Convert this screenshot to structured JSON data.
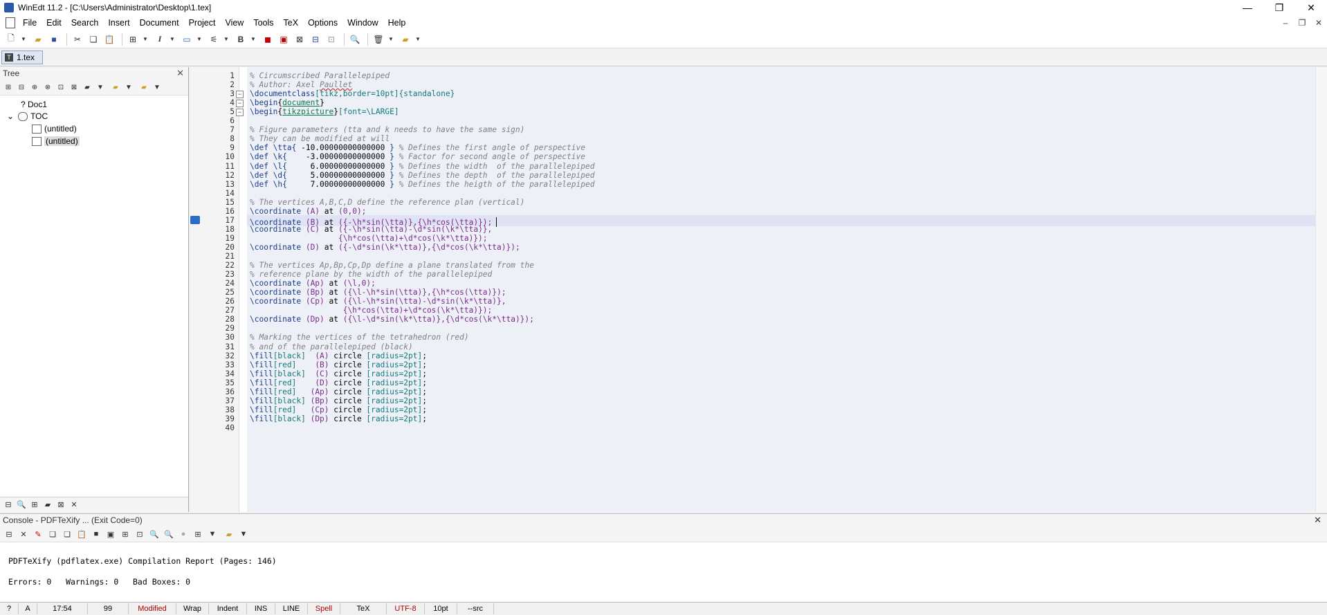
{
  "window": {
    "title": "WinEdt 11.2 - [C:\\Users\\Administrator\\Desktop\\1.tex]",
    "minimize": "—",
    "restore": "❐",
    "close": "✕"
  },
  "menu": [
    "File",
    "Edit",
    "Search",
    "Insert",
    "Document",
    "Project",
    "View",
    "Tools",
    "TeX",
    "Options",
    "Window",
    "Help"
  ],
  "tabs": [
    {
      "label": "1.tex",
      "icon": "T"
    }
  ],
  "tree": {
    "title": "Tree",
    "nodes": [
      {
        "label": "? Doc1",
        "level": 1
      },
      {
        "label": "TOC",
        "level": 0
      },
      {
        "label": "(untitled)",
        "level": 2
      },
      {
        "label": "(untitled)",
        "level": 2,
        "selected": true
      }
    ]
  },
  "editor": {
    "current_line": 17,
    "lines": [
      [
        [
          "c-cmt",
          "% Circumscribed Parallelepiped"
        ]
      ],
      [
        [
          "c-cmt",
          "% Author: Axel "
        ],
        [
          "c-cmt c-sq",
          "Paullet"
        ]
      ],
      [
        [
          "c-cmd",
          "\\documentclass"
        ],
        [
          "c-teal",
          "[tikz,border=10pt]{standalone}"
        ]
      ],
      [
        [
          "c-cmd",
          "\\begin"
        ],
        [
          "c-blk",
          "{"
        ],
        [
          "c-grn",
          "document"
        ],
        [
          "c-blk",
          "}"
        ]
      ],
      [
        [
          "c-cmd",
          "\\begin"
        ],
        [
          "c-blk",
          "{"
        ],
        [
          "c-grn",
          "tikzpicture"
        ],
        [
          "c-blk",
          "}"
        ],
        [
          "c-teal",
          "[font=\\LARGE]"
        ]
      ],
      [],
      [
        [
          "c-cmt",
          "% Figure parameters (tta and k needs to have the same sign)"
        ]
      ],
      [
        [
          "c-cmt",
          "% They can be modified at will"
        ]
      ],
      [
        [
          "c-cmd",
          "\\def \\tta{ "
        ],
        [
          "c-blk",
          "-10.00000000000000 "
        ],
        [
          "c-cmd",
          "} "
        ],
        [
          "c-cmt",
          "% Defines the first angle of perspective"
        ]
      ],
      [
        [
          "c-cmd",
          "\\def \\k{    "
        ],
        [
          "c-blk",
          "-3.00000000000000 "
        ],
        [
          "c-cmd",
          "} "
        ],
        [
          "c-cmt",
          "% Factor for second angle of perspective"
        ]
      ],
      [
        [
          "c-cmd",
          "\\def \\l{     "
        ],
        [
          "c-blk",
          "6.00000000000000 "
        ],
        [
          "c-cmd",
          "} "
        ],
        [
          "c-cmt",
          "% Defines the width  of the parallelepiped"
        ]
      ],
      [
        [
          "c-cmd",
          "\\def \\d{     "
        ],
        [
          "c-blk",
          "5.00000000000000 "
        ],
        [
          "c-cmd",
          "} "
        ],
        [
          "c-cmt",
          "% Defines the depth  of the parallelepiped"
        ]
      ],
      [
        [
          "c-cmd",
          "\\def \\h{     "
        ],
        [
          "c-blk",
          "7.00000000000000 "
        ],
        [
          "c-cmd",
          "} "
        ],
        [
          "c-cmt",
          "% Defines the heigth of the parallelepiped"
        ]
      ],
      [],
      [
        [
          "c-cmt",
          "% The vertices A,B,C,D define the reference plan (vertical)"
        ]
      ],
      [
        [
          "c-cmd",
          "\\coordinate "
        ],
        [
          "c-pur",
          "(A) "
        ],
        [
          "c-blk",
          "at "
        ],
        [
          "c-pur",
          "(0,0);"
        ]
      ],
      [
        [
          "c-cmd",
          "\\coordinate "
        ],
        [
          "c-pur",
          "(B) "
        ],
        [
          "c-blk",
          "at "
        ],
        [
          "c-pur",
          "({-\\h*sin(\\tta)},{\\h*cos(\\tta)});"
        ]
      ],
      [
        [
          "c-cmd",
          "\\coordinate "
        ],
        [
          "c-pur",
          "(C) "
        ],
        [
          "c-blk",
          "at "
        ],
        [
          "c-pur",
          "({-\\h*sin(\\tta)-\\d*sin(\\k*\\tta)},"
        ]
      ],
      [
        [
          "c-pur",
          "                   {\\h*cos(\\tta)+\\d*cos(\\k*\\tta)});"
        ]
      ],
      [
        [
          "c-cmd",
          "\\coordinate "
        ],
        [
          "c-pur",
          "(D) "
        ],
        [
          "c-blk",
          "at "
        ],
        [
          "c-pur",
          "({-\\d*sin(\\k*\\tta)},{\\d*cos(\\k*\\tta)});"
        ]
      ],
      [],
      [
        [
          "c-cmt",
          "% The vertices Ap,Bp,Cp,Dp define a plane translated from the"
        ]
      ],
      [
        [
          "c-cmt",
          "% reference plane by the width of the parallelepiped"
        ]
      ],
      [
        [
          "c-cmd",
          "\\coordinate "
        ],
        [
          "c-pur",
          "(Ap) "
        ],
        [
          "c-blk",
          "at "
        ],
        [
          "c-pur",
          "(\\l,0);"
        ]
      ],
      [
        [
          "c-cmd",
          "\\coordinate "
        ],
        [
          "c-pur",
          "(Bp) "
        ],
        [
          "c-blk",
          "at "
        ],
        [
          "c-pur",
          "({\\l-\\h*sin(\\tta)},{\\h*cos(\\tta)});"
        ]
      ],
      [
        [
          "c-cmd",
          "\\coordinate "
        ],
        [
          "c-pur",
          "(Cp) "
        ],
        [
          "c-blk",
          "at "
        ],
        [
          "c-pur",
          "({\\l-\\h*sin(\\tta)-\\d*sin(\\k*\\tta)},"
        ]
      ],
      [
        [
          "c-pur",
          "                    {\\h*cos(\\tta)+\\d*cos(\\k*\\tta)});"
        ]
      ],
      [
        [
          "c-cmd",
          "\\coordinate "
        ],
        [
          "c-pur",
          "(Dp) "
        ],
        [
          "c-blk",
          "at "
        ],
        [
          "c-pur",
          "({\\l-\\d*sin(\\k*\\tta)},{\\d*cos(\\k*\\tta)});"
        ]
      ],
      [],
      [
        [
          "c-cmt",
          "% Marking the vertices of the tetrahedron (red)"
        ]
      ],
      [
        [
          "c-cmt",
          "% and of the parallelepiped (black)"
        ]
      ],
      [
        [
          "c-cmd",
          "\\fill"
        ],
        [
          "c-teal",
          "[black]  "
        ],
        [
          "c-pur",
          "(A) "
        ],
        [
          "c-blk",
          "circle "
        ],
        [
          "c-teal",
          "[radius=2pt]"
        ],
        [
          "c-blk",
          ";"
        ]
      ],
      [
        [
          "c-cmd",
          "\\fill"
        ],
        [
          "c-teal",
          "[red]    "
        ],
        [
          "c-pur",
          "(B) "
        ],
        [
          "c-blk",
          "circle "
        ],
        [
          "c-teal",
          "[radius=2pt]"
        ],
        [
          "c-blk",
          ";"
        ]
      ],
      [
        [
          "c-cmd",
          "\\fill"
        ],
        [
          "c-teal",
          "[black]  "
        ],
        [
          "c-pur",
          "(C) "
        ],
        [
          "c-blk",
          "circle "
        ],
        [
          "c-teal",
          "[radius=2pt]"
        ],
        [
          "c-blk",
          ";"
        ]
      ],
      [
        [
          "c-cmd",
          "\\fill"
        ],
        [
          "c-teal",
          "[red]    "
        ],
        [
          "c-pur",
          "(D) "
        ],
        [
          "c-blk",
          "circle "
        ],
        [
          "c-teal",
          "[radius=2pt]"
        ],
        [
          "c-blk",
          ";"
        ]
      ],
      [
        [
          "c-cmd",
          "\\fill"
        ],
        [
          "c-teal",
          "[red]   "
        ],
        [
          "c-pur",
          "(Ap) "
        ],
        [
          "c-blk",
          "circle "
        ],
        [
          "c-teal",
          "[radius=2pt]"
        ],
        [
          "c-blk",
          ";"
        ]
      ],
      [
        [
          "c-cmd",
          "\\fill"
        ],
        [
          "c-teal",
          "[black] "
        ],
        [
          "c-pur",
          "(Bp) "
        ],
        [
          "c-blk",
          "circle "
        ],
        [
          "c-teal",
          "[radius=2pt]"
        ],
        [
          "c-blk",
          ";"
        ]
      ],
      [
        [
          "c-cmd",
          "\\fill"
        ],
        [
          "c-teal",
          "[red]   "
        ],
        [
          "c-pur",
          "(Cp) "
        ],
        [
          "c-blk",
          "circle "
        ],
        [
          "c-teal",
          "[radius=2pt]"
        ],
        [
          "c-blk",
          ";"
        ]
      ],
      [
        [
          "c-cmd",
          "\\fill"
        ],
        [
          "c-teal",
          "[black] "
        ],
        [
          "c-pur",
          "(Dp) "
        ],
        [
          "c-blk",
          "circle "
        ],
        [
          "c-teal",
          "[radius=2pt]"
        ],
        [
          "c-blk",
          ";"
        ]
      ],
      []
    ],
    "fold_lines": [
      3,
      4,
      5
    ]
  },
  "console": {
    "title": "Console - PDFTeXify ... (Exit Code=0)",
    "report": "PDFTeXify (pdflatex.exe) Compilation Report (Pages: 146)",
    "summary": "Errors: 0   Warnings: 0   Bad Boxes: 0"
  },
  "status": [
    "?",
    "A",
    "17:54",
    "99",
    "Modified",
    "Wrap",
    "Indent",
    "INS",
    "LINE",
    "Spell",
    "TeX",
    "UTF-8",
    "10pt",
    "--src"
  ],
  "status_red": [
    "Modified",
    "Spell",
    "UTF-8"
  ],
  "icons": {
    "toolbar": [
      "new-icon",
      "open-icon",
      "save-icon",
      "cut-icon",
      "copy-icon",
      "paste-icon",
      "tree-icon",
      "italic-icon",
      "image-icon",
      "macro-icon",
      "bold-icon",
      "pdf-icon",
      "pdf-tex-icon",
      "preview-icon",
      "compile-icon",
      "build-icon",
      "search-icon",
      "trash-icon",
      "project-icon"
    ]
  }
}
